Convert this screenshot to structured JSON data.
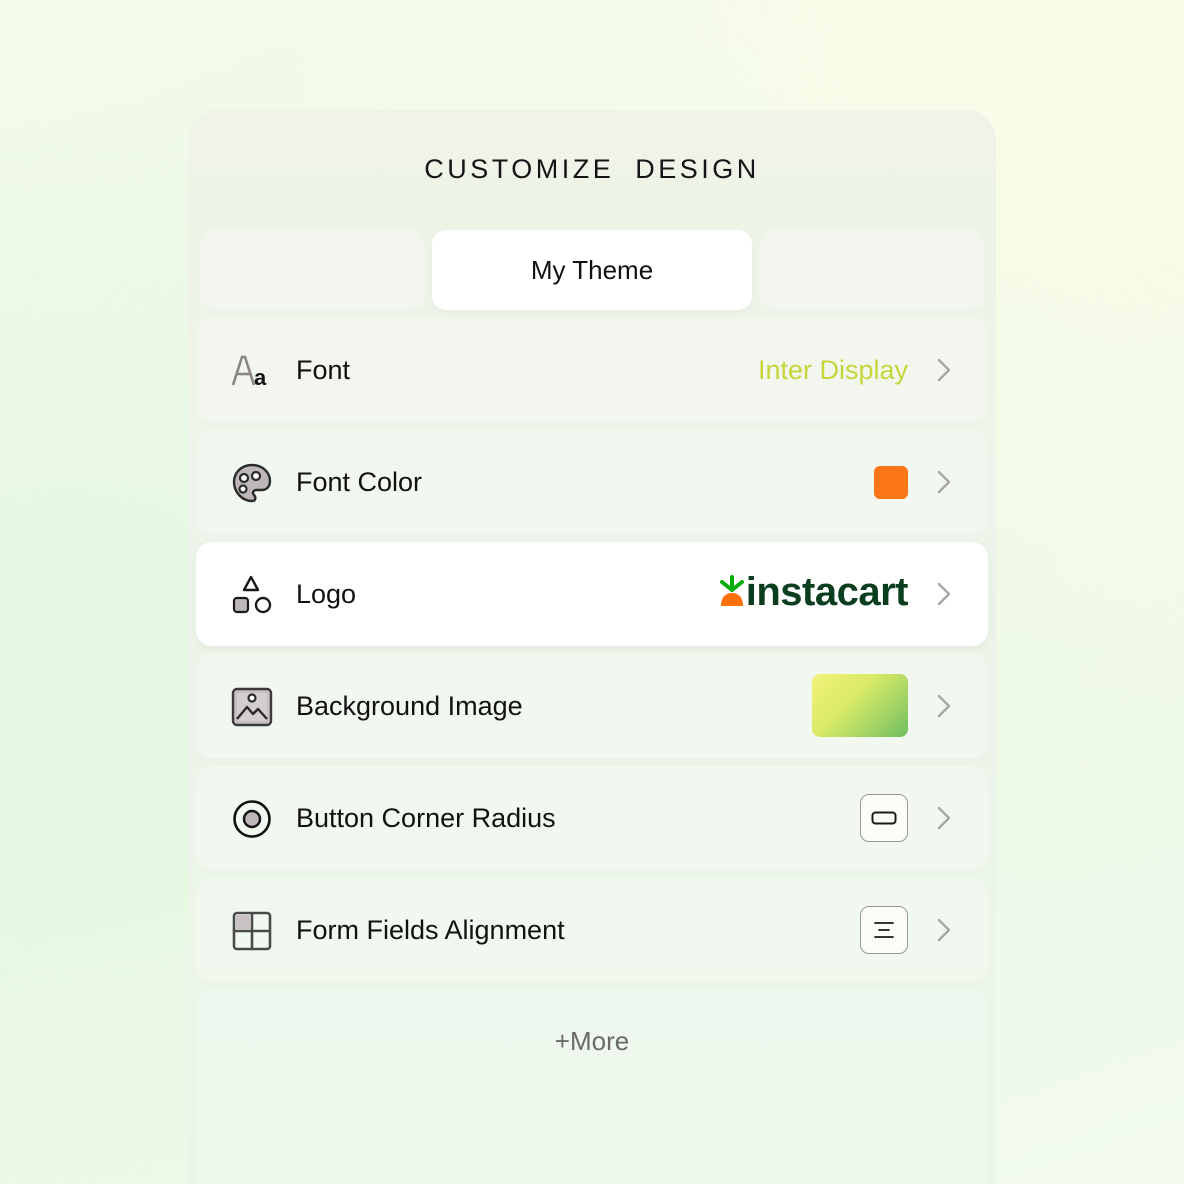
{
  "header": {
    "title": "CUSTOMIZE DESIGN"
  },
  "tabs": [
    {
      "label": ""
    },
    {
      "label": "My Theme",
      "active": true
    },
    {
      "label": ""
    }
  ],
  "settings": [
    {
      "label": "Font",
      "icon": "font-icon",
      "value": "Inter Display",
      "value_color": "#c6d63a"
    },
    {
      "label": "Font Color",
      "icon": "palette-icon",
      "swatch_color": "#fb7617"
    },
    {
      "label": "Logo",
      "icon": "shapes-icon",
      "logo_text": "instacart",
      "logo_color": "#0b3d1f"
    },
    {
      "label": "Background Image",
      "icon": "image-icon"
    },
    {
      "label": "Button Corner Radius",
      "icon": "radio-target-icon"
    },
    {
      "label": "Form Fields Alignment",
      "icon": "grid-icon"
    }
  ],
  "more": {
    "label": "+More"
  }
}
